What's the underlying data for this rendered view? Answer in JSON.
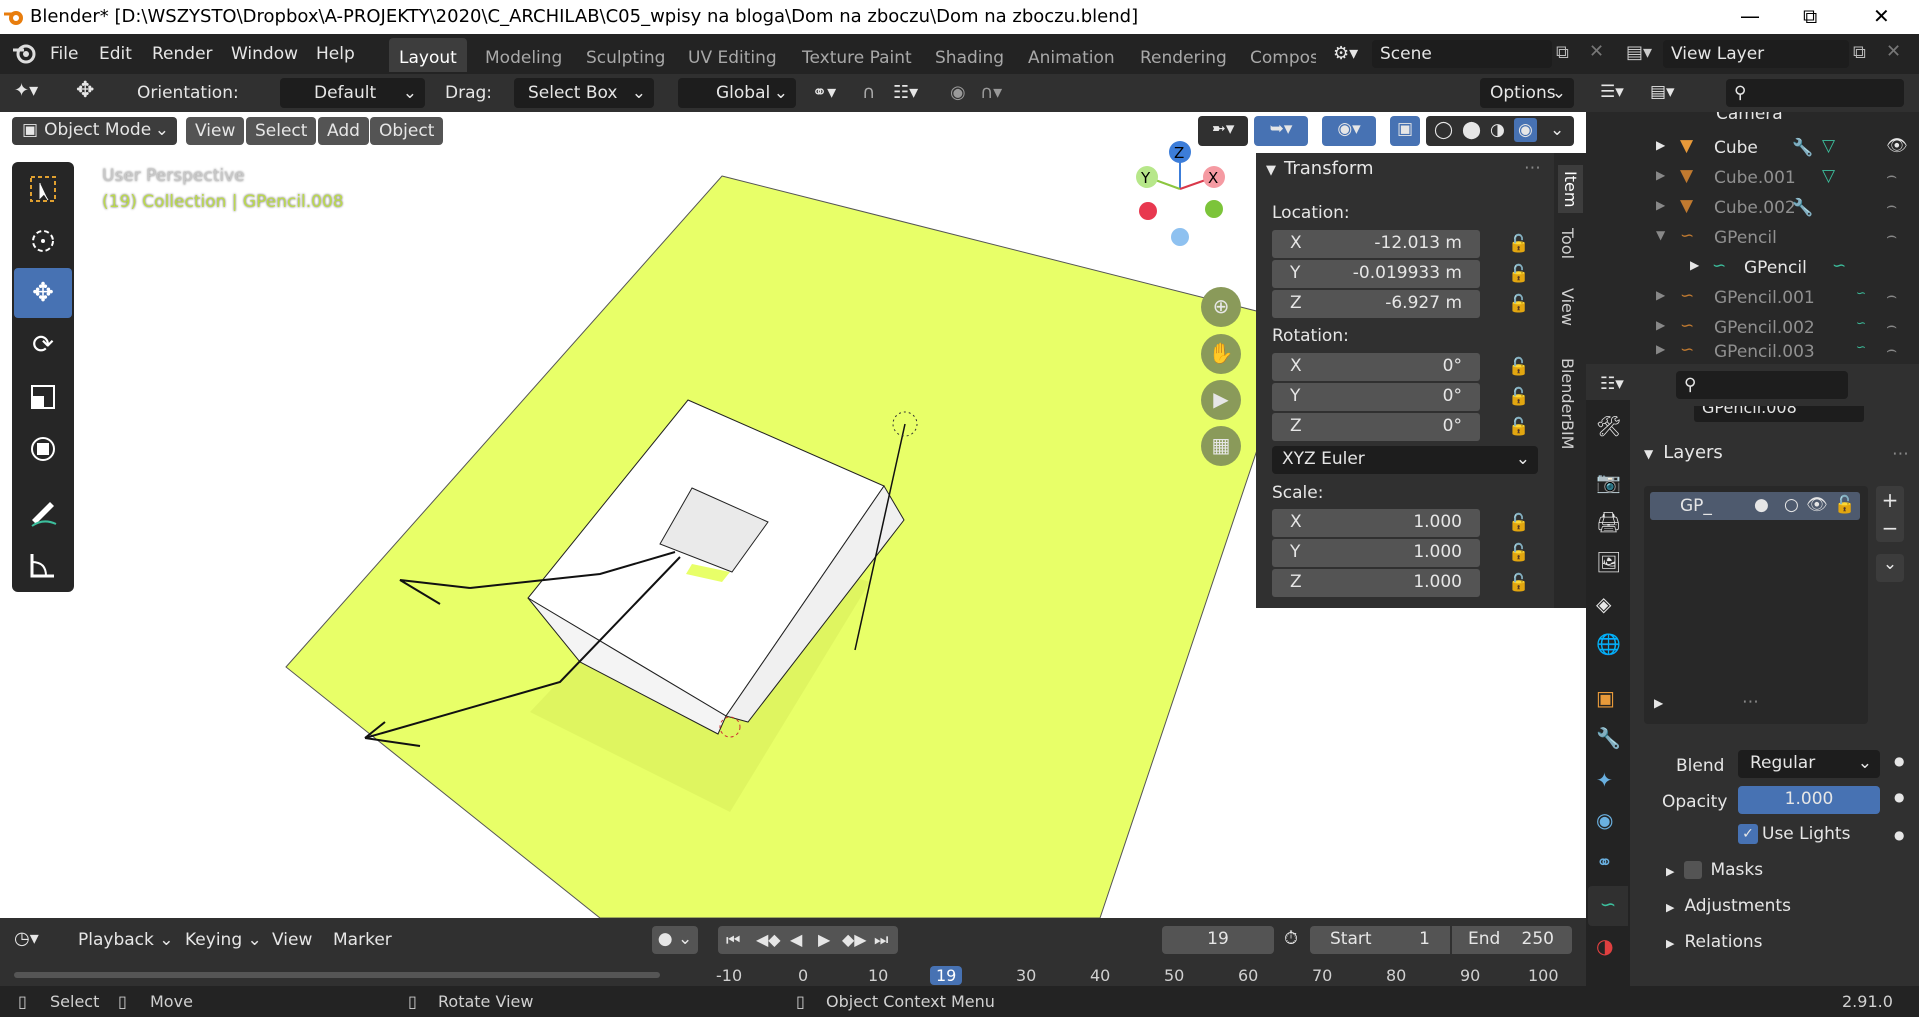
{
  "window": {
    "title": "Blender* [D:\\WSZYSTO\\Dropbox\\A-PROJEKTY\\2020\\C_ARCHILAB\\C05_wpisy na bloga\\Dom na zboczu\\Dom na zboczu.blend]"
  },
  "menu": [
    "File",
    "Edit",
    "Render",
    "Window",
    "Help"
  ],
  "workspaces": [
    {
      "label": "Layout",
      "active": true
    },
    {
      "label": "Modeling"
    },
    {
      "label": "Sculpting"
    },
    {
      "label": "UV Editing"
    },
    {
      "label": "Texture Paint"
    },
    {
      "label": "Shading"
    },
    {
      "label": "Animation"
    },
    {
      "label": "Rendering"
    },
    {
      "label": "Compos"
    }
  ],
  "scene": {
    "name": "Scene"
  },
  "view_layer": {
    "name": "View Layer"
  },
  "tool_header": {
    "orientation_label": "Orientation:",
    "orientation_value": "Default",
    "drag_label": "Drag:",
    "drag_value": "Select Box",
    "transform_orientation": "Global",
    "options": "Options"
  },
  "viewport": {
    "mode": "Object Mode",
    "menus": [
      "View",
      "Select",
      "Add",
      "Object"
    ],
    "overlay_text_1": "User Perspective",
    "overlay_text_2": "(19) Collection | GPencil.008",
    "gizmo": {
      "z": "Z",
      "y": "Y",
      "x": "X"
    },
    "plane_color": "#e8ff68"
  },
  "transform": {
    "title": "Transform",
    "location_label": "Location:",
    "location": {
      "x": "-12.013 m",
      "y": "-0.019933 m",
      "z": "-6.927 m"
    },
    "rotation_label": "Rotation:",
    "rotation": {
      "x": "0°",
      "y": "0°",
      "z": "0°"
    },
    "rotation_mode": "XYZ Euler",
    "scale_label": "Scale:",
    "scale": {
      "x": "1.000",
      "y": "1.000",
      "z": "1.000"
    },
    "axis": {
      "x": "X",
      "y": "Y",
      "z": "Z"
    }
  },
  "side_tabs": [
    "Item",
    "Tool",
    "View",
    "BlenderBIM"
  ],
  "outliner": {
    "rows": [
      {
        "label": "Camera",
        "color": "#e6e6e6"
      },
      {
        "label": "Cube",
        "color": "#e6e6e6"
      },
      {
        "label": "Cube.001",
        "color": "#909090"
      },
      {
        "label": "Cube.002",
        "color": "#909090"
      },
      {
        "label": "GPencil",
        "color": "#909090"
      },
      {
        "label": "GPencil",
        "color": "#e6e6e6"
      },
      {
        "label": "GPencil.001",
        "color": "#909090"
      },
      {
        "label": "GPencil.002",
        "color": "#909090"
      },
      {
        "label": "GPencil.003",
        "color": "#909090"
      }
    ]
  },
  "properties": {
    "object_name": "GPencil.008",
    "layers_title": "Layers",
    "layer_name": "GP_",
    "blend_label": "Blend",
    "blend_value": "Regular",
    "opacity_label": "Opacity",
    "opacity_value": "1.000",
    "use_lights": "Use Lights",
    "masks": "Masks",
    "adjustments": "Adjustments",
    "relations": "Relations"
  },
  "timeline": {
    "menus": [
      "Playback",
      "Keying",
      "View",
      "Marker"
    ],
    "current_frame": "19",
    "start_label": "Start",
    "start": "1",
    "end_label": "End",
    "end": "250",
    "ticks": [
      "-10",
      "0",
      "10",
      "19",
      "30",
      "40",
      "50",
      "60",
      "70",
      "80",
      "90",
      "100"
    ]
  },
  "status": {
    "select": "Select",
    "move": "Move",
    "rotate": "Rotate View",
    "context": "Object Context Menu",
    "version": "2.91.0"
  }
}
